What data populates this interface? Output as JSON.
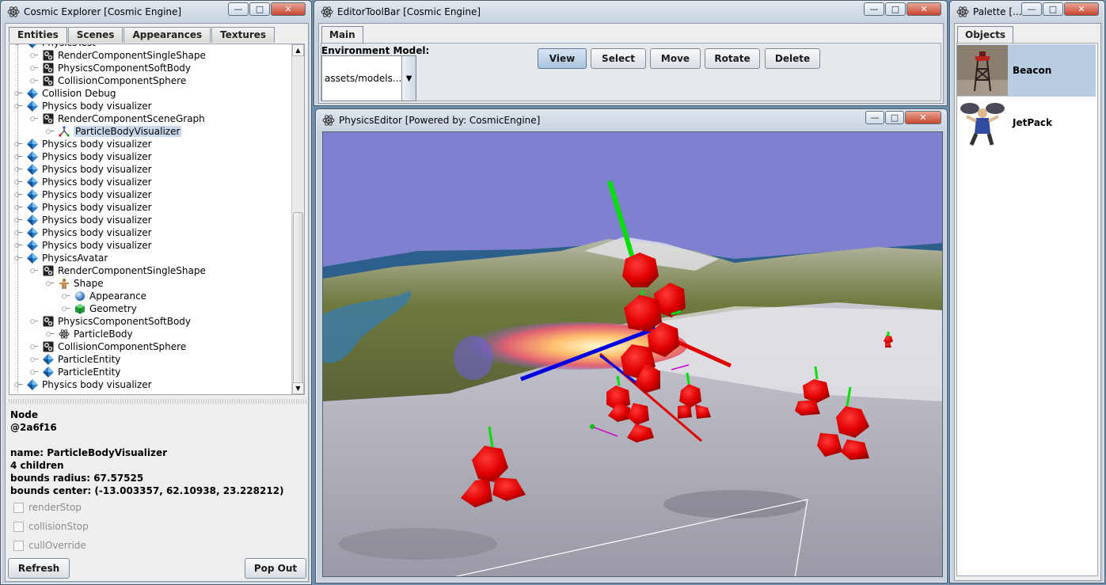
{
  "explorer": {
    "title": "Cosmic Explorer [Cosmic Engine]",
    "tabs": [
      "Entities",
      "Scenes",
      "Appearances",
      "Textures"
    ],
    "tree": [
      {
        "label": "PhysicsTest",
        "icon": "entity-diamond-icon",
        "indent": 0
      },
      {
        "label": "RenderComponentSingleShape",
        "icon": "component-gear-icon",
        "indent": 1
      },
      {
        "label": "PhysicsComponentSoftBody",
        "icon": "component-gear-icon",
        "indent": 1
      },
      {
        "label": "CollisionComponentSphere",
        "icon": "component-gear-icon",
        "indent": 1
      },
      {
        "label": "Collision Debug",
        "icon": "entity-diamond-icon",
        "indent": 0
      },
      {
        "label": "Physics body visualizer",
        "icon": "entity-diamond-icon",
        "indent": 0
      },
      {
        "label": "RenderComponentSceneGraph",
        "icon": "component-gear-icon",
        "indent": 1
      },
      {
        "label": "ParticleBodyVisualizer",
        "icon": "node-branch-icon",
        "indent": 2,
        "selected": true
      },
      {
        "label": "Physics body visualizer",
        "icon": "entity-diamond-icon",
        "indent": 0
      },
      {
        "label": "Physics body visualizer",
        "icon": "entity-diamond-icon",
        "indent": 0
      },
      {
        "label": "Physics body visualizer",
        "icon": "entity-diamond-icon",
        "indent": 0
      },
      {
        "label": "Physics body visualizer",
        "icon": "entity-diamond-icon",
        "indent": 0
      },
      {
        "label": "Physics body visualizer",
        "icon": "entity-diamond-icon",
        "indent": 0
      },
      {
        "label": "Physics body visualizer",
        "icon": "entity-diamond-icon",
        "indent": 0
      },
      {
        "label": "Physics body visualizer",
        "icon": "entity-diamond-icon",
        "indent": 0
      },
      {
        "label": "Physics body visualizer",
        "icon": "entity-diamond-icon",
        "indent": 0
      },
      {
        "label": "Physics body visualizer",
        "icon": "entity-diamond-icon",
        "indent": 0
      },
      {
        "label": "PhysicsAvatar",
        "icon": "entity-diamond-icon",
        "indent": 0
      },
      {
        "label": "RenderComponentSingleShape",
        "icon": "component-gear-icon",
        "indent": 1
      },
      {
        "label": "Shape",
        "icon": "shape-figure-icon",
        "indent": 2
      },
      {
        "label": "Appearance",
        "icon": "appearance-sphere-icon",
        "indent": 3
      },
      {
        "label": "Geometry",
        "icon": "geometry-cube-icon",
        "indent": 3
      },
      {
        "label": "PhysicsComponentSoftBody",
        "icon": "component-gear-icon",
        "indent": 1
      },
      {
        "label": "ParticleBody",
        "icon": "particle-atom-icon",
        "indent": 2
      },
      {
        "label": "CollisionComponentSphere",
        "icon": "component-gear-icon",
        "indent": 1
      },
      {
        "label": "ParticleEntity",
        "icon": "entity-diamond-icon",
        "indent": 1
      },
      {
        "label": "ParticleEntity",
        "icon": "entity-diamond-icon",
        "indent": 1
      },
      {
        "label": "Physics body visualizer",
        "icon": "entity-diamond-icon",
        "indent": 0
      }
    ],
    "info": {
      "type": "Node",
      "id": "@2a6f16",
      "name": "name: ParticleBodyVisualizer",
      "children": "4 children",
      "radius": "bounds radius: 67.57525",
      "center": "bounds center: (-13.003357, 62.10938, 23.228212)"
    },
    "checkboxes": [
      "renderStop",
      "collisionStop",
      "cullOverride"
    ],
    "refresh_label": "Refresh",
    "popout_label": "Pop Out"
  },
  "toolbar": {
    "title": "EditorToolBar [Cosmic Engine]",
    "tab": "Main",
    "env_label": "Environment Model:",
    "env_value": "assets/models...",
    "buttons": [
      "View",
      "Select",
      "Move",
      "Rotate",
      "Delete"
    ],
    "active_button": "View"
  },
  "editor": {
    "title": "PhysicsEditor [Powered by: CosmicEngine]"
  },
  "palette": {
    "title": "Palette [...",
    "tab": "Objects",
    "items": [
      {
        "label": "Beacon",
        "icon": "beacon-tower-icon",
        "selected": true
      },
      {
        "label": "JetPack",
        "icon": "jetpack-figure-icon",
        "selected": false
      }
    ]
  },
  "colors": {
    "sky": "#7f80cf",
    "selection": "#b8cce2",
    "red_body": "#e00000",
    "axis_green": "#00e000",
    "axis_blue": "#0000e0"
  }
}
